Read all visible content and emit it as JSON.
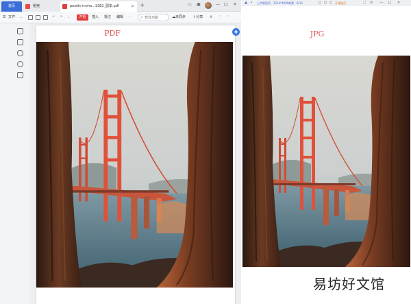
{
  "tabs": {
    "home": "首页",
    "store": "稻壳",
    "pdf": "pexels-moha...1382_副本.pdf",
    "new": "+"
  },
  "toolbar": {
    "menu": "文件",
    "start": "开始",
    "insert": "插入",
    "annotate": "批注",
    "edit": "编辑",
    "search_placeholder": "查找功能",
    "cloud": "未同步",
    "share": "分享"
  },
  "left_page": {
    "label": "PDF"
  },
  "right_window": {
    "toolbar_text": "上传到稻壳 · 3224*4809像素 · 6/12",
    "action": "开通会员",
    "label": "JPG"
  },
  "watermark": "易坊好文馆",
  "colors": {
    "accent": "#3a6fd8",
    "start_red": "#e33c3c",
    "label_red": "#d9534f"
  },
  "icons": [
    "bookmark-icon",
    "thumbnail-icon",
    "comment-icon",
    "attachment-icon",
    "signature-icon",
    "search-icon",
    "close-icon",
    "minimize-icon",
    "maximize-icon"
  ]
}
